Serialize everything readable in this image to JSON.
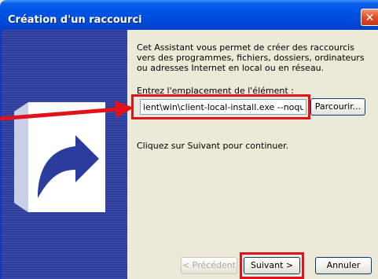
{
  "window": {
    "title": "Création d'un raccourci"
  },
  "content": {
    "description": "Cet Assistant vous permet de créer des raccourcis vers des programmes, fichiers, dossiers, ordinateurs ou adresses Internet en local ou en réseau.",
    "location_label": "Entrez l'emplacement de l'élément :",
    "location_value": "ient\\win\\client-local-install.exe --noquit",
    "browse_label": "Parcourir...",
    "hint": "Cliquez sur Suivant pour continuer."
  },
  "footer": {
    "back_label": "< Précédent",
    "next_label": "Suivant >",
    "cancel_label": "Annuler"
  },
  "icons": {
    "close": "close-icon",
    "banner": "shortcut-arrow-icon"
  },
  "colors": {
    "titlebar": "#0054E3",
    "banner": "#2B3C9C",
    "highlight": "#E1121C",
    "face": "#ECE9D8"
  }
}
